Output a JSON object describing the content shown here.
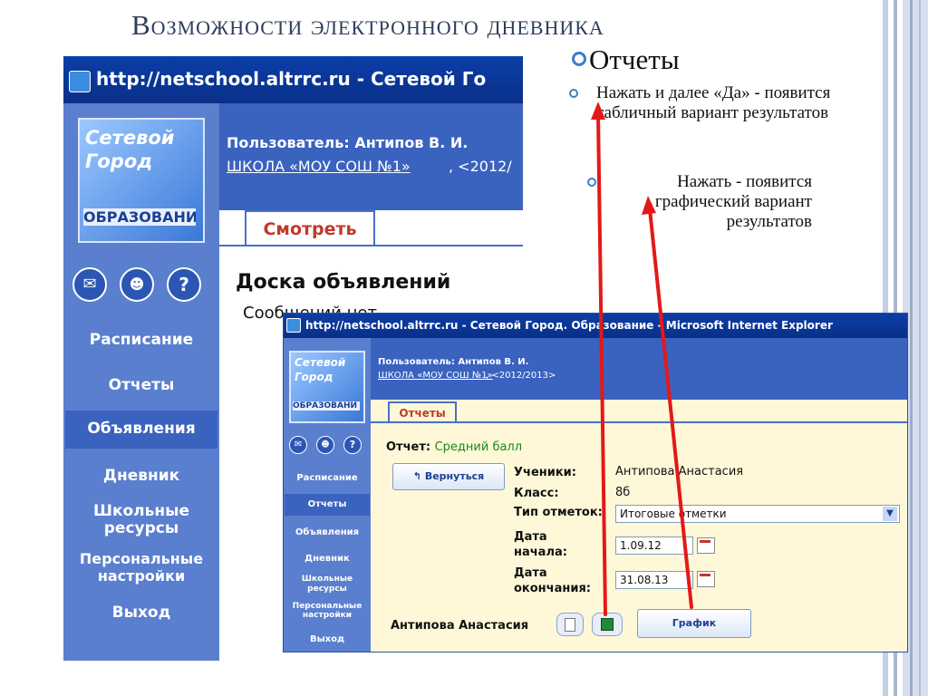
{
  "slide": {
    "title": "Возможности электронного дневника",
    "bullet_main": "Отчеты",
    "bullet_sub1": "Нажать и далее «Да» - появится табличный вариант результатов",
    "bullet_sub2": "Нажать - появится графический вариант результатов",
    "accent": "#3d7fc4"
  },
  "screen1": {
    "window_title": "http://netschool.altrrc.ru - Сетевой Го",
    "logo_line1": "Сетевой",
    "logo_line2": "Город",
    "logo_line3": "ОБРАЗОВАНИ",
    "user_line": "Пользователь: Антипов В. И.",
    "school_link": "ШКОЛА «МОУ СОШ №1»",
    "year_fragment": ", <2012/",
    "tab_label": "Смотреть",
    "board_title": "Доска объявлений",
    "board_msg": "Сообщений нет",
    "nav": [
      "Расписание",
      "Отчеты",
      "Объявления",
      "Дневник",
      "Школьные ресурсы",
      "Персональные настройки",
      "Выход"
    ]
  },
  "screen2": {
    "window_title": "http://netschool.altrrc.ru - Сетевой Город. Образование - Microsoft Internet Explorer",
    "logo_line1": "Сетевой",
    "logo_line2": "Город",
    "logo_line3": "ОБРАЗОВАНИ",
    "user_line": "Пользователь: Антипов В. И.",
    "school_link": "ШКОЛА «МОУ СОШ №1»",
    "year_fragment": ", <2012/2013>",
    "tab_label": "Отчеты",
    "report_label": "Отчет:",
    "report_name": "Средний балл",
    "back_button": "Вернуться",
    "students_label": "Ученики:",
    "students_value": "Антипова Анастасия",
    "class_label": "Класс:",
    "class_value": "8б",
    "marks_type_label": "Тип отметок:",
    "marks_type_value": "Итоговые отметки",
    "start_label": "Дата начала:",
    "start_value": "1.09.12",
    "end_label": "Дата окончания:",
    "end_value": "31.08.13",
    "student_name": "Антипова Анастасия",
    "chart_button": "График",
    "nav": [
      "Расписание",
      "Отчеты",
      "Объявления",
      "Дневник",
      "Школьные ресурсы",
      "Персональные настройки",
      "Выход"
    ]
  }
}
